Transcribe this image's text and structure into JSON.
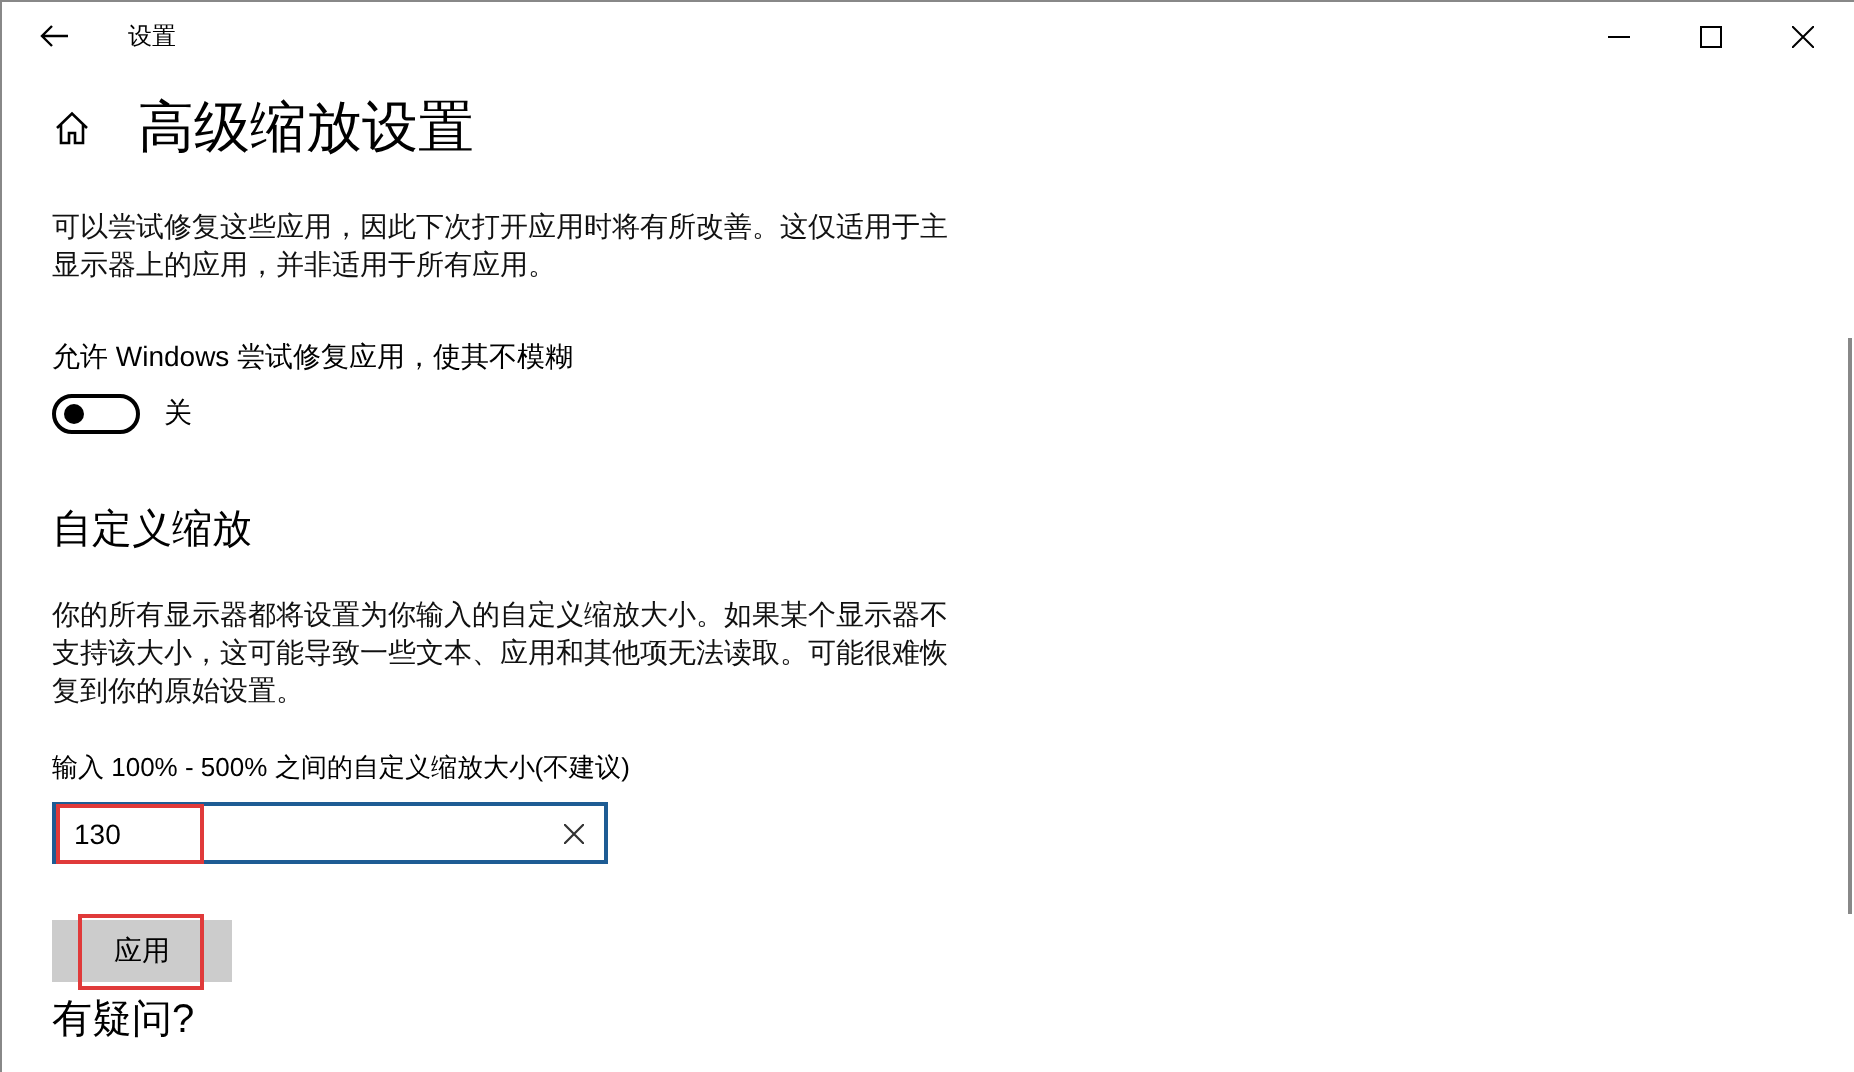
{
  "window": {
    "title": "设置"
  },
  "page": {
    "title": "高级缩放设置"
  },
  "fix_apps": {
    "description": "可以尝试修复这些应用，因此下次打开应用时将有所改善。这仅适用于主显示器上的应用，并非适用于所有应用。",
    "toggle_label": "允许 Windows 尝试修复应用，使其不模糊",
    "toggle": {
      "on": false,
      "state_text": "关"
    }
  },
  "custom_scaling": {
    "heading": "自定义缩放",
    "description": "你的所有显示器都将设置为你输入的自定义缩放大小。如果某个显示器不支持该大小，这可能导致一些文本、应用和其他项无法读取。可能很难恢复到你的原始设置。",
    "field_label": "输入 100% - 500% 之间的自定义缩放大小(不建议)",
    "field": {
      "value": "130",
      "highlighted": true
    },
    "apply_button": {
      "label": "应用",
      "highlighted": true
    }
  },
  "help": {
    "heading": "有疑问?"
  }
}
